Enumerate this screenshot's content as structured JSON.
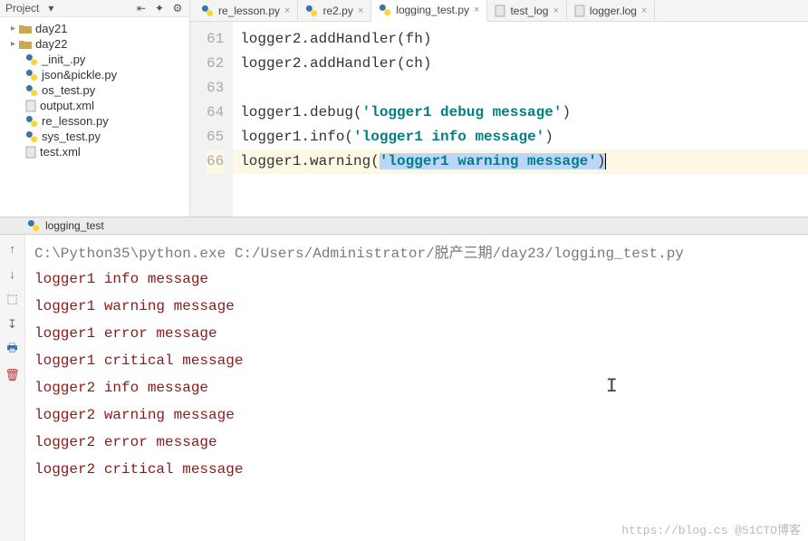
{
  "sidebar": {
    "header": "Project",
    "tree": [
      {
        "type": "folder",
        "label": "day21",
        "indent": 0
      },
      {
        "type": "folder",
        "label": "day22",
        "indent": 0
      },
      {
        "type": "py",
        "label": "_init_.py",
        "indent": 1
      },
      {
        "type": "py",
        "label": "json&pickle.py",
        "indent": 1
      },
      {
        "type": "py",
        "label": "os_test.py",
        "indent": 1
      },
      {
        "type": "xml",
        "label": "output.xml",
        "indent": 1
      },
      {
        "type": "py",
        "label": "re_lesson.py",
        "indent": 1
      },
      {
        "type": "py",
        "label": "sys_test.py",
        "indent": 1
      },
      {
        "type": "xml",
        "label": "test.xml",
        "indent": 1
      }
    ]
  },
  "tabs": [
    {
      "label": "re_lesson.py",
      "type": "py",
      "active": false
    },
    {
      "label": "re2.py",
      "type": "py",
      "active": false
    },
    {
      "label": "logging_test.py",
      "type": "py",
      "active": true
    },
    {
      "label": "test_log",
      "type": "txt",
      "active": false
    },
    {
      "label": "logger.log",
      "type": "txt",
      "active": false
    }
  ],
  "code": {
    "start": 61,
    "lines": [
      {
        "n": 61,
        "pre": "logger2.addHandler(fh)"
      },
      {
        "n": 62,
        "pre": "logger2.addHandler(ch)"
      },
      {
        "n": 63,
        "pre": ""
      },
      {
        "n": 64,
        "pre": "logger1.debug(",
        "str": "'logger1 debug message'",
        "post": ")"
      },
      {
        "n": 65,
        "pre": "logger1.info(",
        "str": "'logger1 info message'",
        "post": ")"
      },
      {
        "n": 66,
        "pre": "logger1.warning(",
        "str": "'logger1 warning message'",
        "post": ")",
        "hl": true,
        "sel": true
      }
    ]
  },
  "run": {
    "tab": "logging_test"
  },
  "console": {
    "command": "C:\\Python35\\python.exe C:/Users/Administrator/脱产三期/day23/logging_test.py",
    "out": [
      "logger1 info message",
      "logger1 warning message",
      "logger1 error message",
      "logger1 critical message",
      "logger2 info message",
      "logger2 warning message",
      "logger2 error message",
      "logger2 critical message"
    ]
  },
  "watermark": "https://blog.cs @51CTO博客"
}
